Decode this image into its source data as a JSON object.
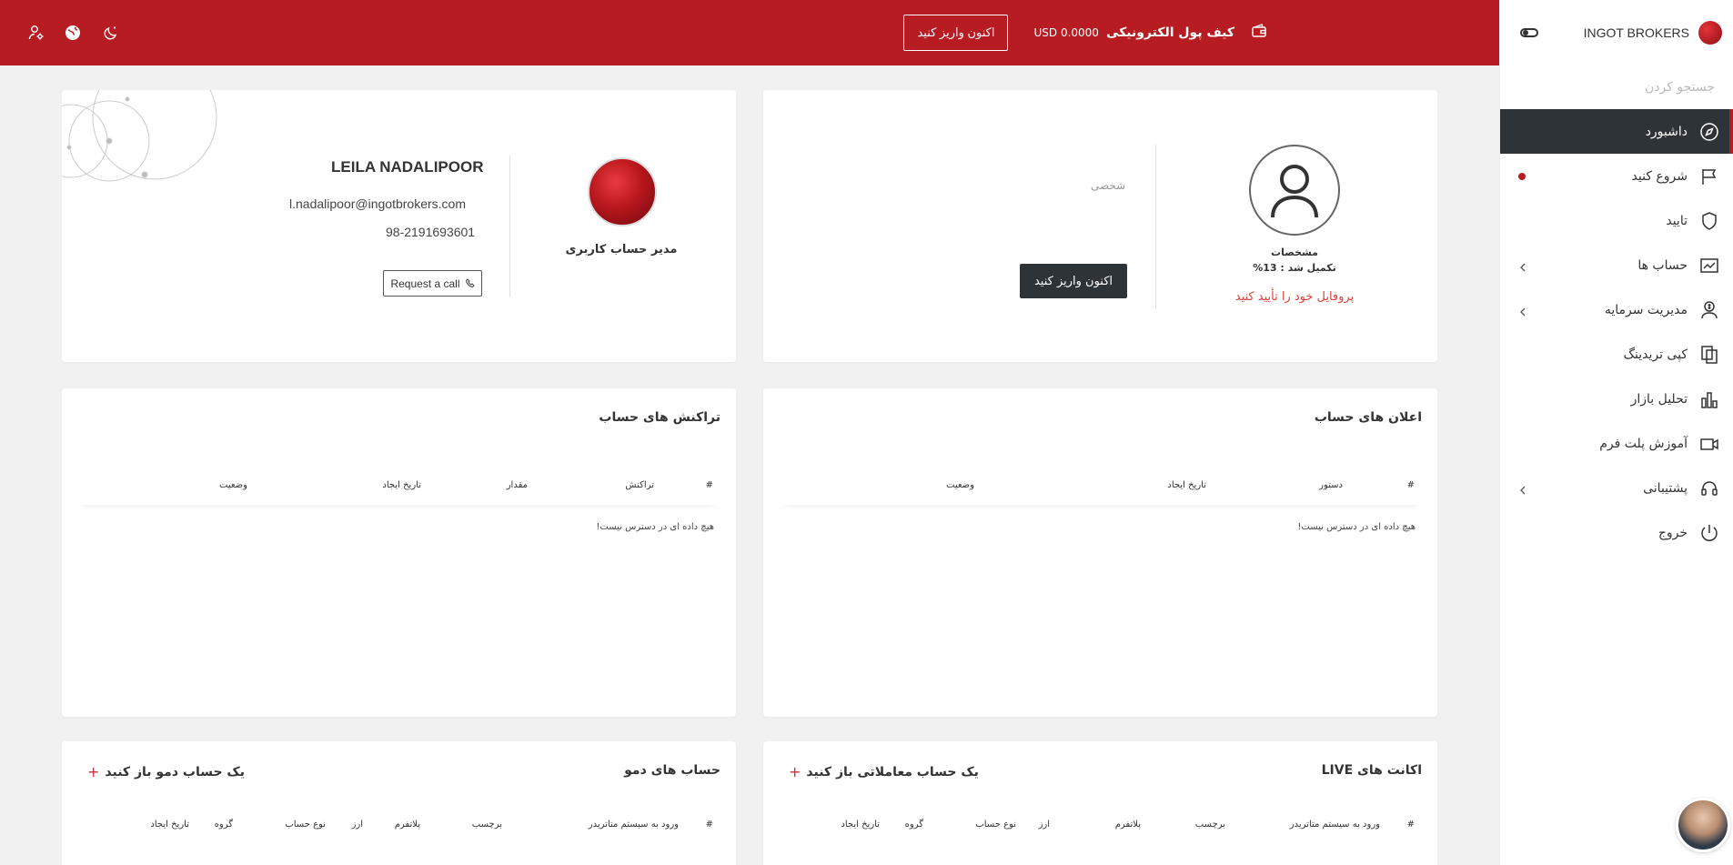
{
  "topbar": {
    "wallet_label": "کیف پول الکترونیکی",
    "wallet_amount": "USD 0.0000",
    "deposit_button": "اکنون واریز کنید"
  },
  "sidebar": {
    "brand": "INGOT BROKERS",
    "search_placeholder": "جستجو کردن",
    "items": [
      {
        "label": "داشبورد",
        "icon": "compass-icon"
      },
      {
        "label": "شروع کنید",
        "icon": "flag-icon"
      },
      {
        "label": "تایید",
        "icon": "shield-icon"
      },
      {
        "label": "حساب ها",
        "icon": "chart-icon"
      },
      {
        "label": "مدیریت سرمایه",
        "icon": "money-user-icon"
      },
      {
        "label": "کپی تریدینگ",
        "icon": "copy-icon"
      },
      {
        "label": "تحلیل بازار",
        "icon": "bar-chart-icon"
      },
      {
        "label": "آموزش پلت فرم",
        "icon": "video-icon"
      },
      {
        "label": "پشتیبانی",
        "icon": "headset-icon"
      },
      {
        "label": "خروج",
        "icon": "power-icon"
      }
    ]
  },
  "profile": {
    "specs": "مشخصات",
    "completion": "تکمیل شد : 13%",
    "verify_link": "پروفایل خود را تأیید کنید",
    "personal": "شخصی",
    "deposit_button": "اکنون واریز کنید"
  },
  "manager": {
    "role": "مدیر حساب کاربری",
    "name": "LEILA NADALIPOOR",
    "email": "l.nadalipoor@ingotbrokers.com",
    "phone": "98-2191693601",
    "call_button": "Request a call"
  },
  "announcements": {
    "title": "اعلان های حساب",
    "columns": [
      "#",
      "دستور",
      "تاریخ ایجاد",
      "وضعیت"
    ],
    "empty": "هیچ داده ای در دسترس نیست!"
  },
  "transactions": {
    "title": "تراکنش های حساب",
    "columns": [
      "#",
      "تراکنش",
      "مقدار",
      "تاریخ ایجاد",
      "وضعیت"
    ],
    "empty": "هیچ داده ای در دسترس نیست!"
  },
  "live": {
    "title": "اکانت های LIVE",
    "add_link": "یک حساب معاملاتی باز کنید",
    "columns": [
      "#",
      "ورود به سیستم متاتریدر",
      "برچسب",
      "پلاتفرم",
      "ارز",
      "نوع حساب",
      "گروه",
      "تاریخ ایجاد"
    ]
  },
  "demo": {
    "title": "حساب های دمو",
    "add_link": "یک حساب دمو باز کنید",
    "columns": [
      "#",
      "ورود به سیستم متاتریدر",
      "برچسب",
      "پلاتفرم",
      "ارز",
      "نوع حساب",
      "گروه",
      "تاریخ ایجاد"
    ]
  },
  "colors": {
    "brand_red": "#b71c22",
    "dark": "#2e3338",
    "link_red": "#e0413a"
  }
}
